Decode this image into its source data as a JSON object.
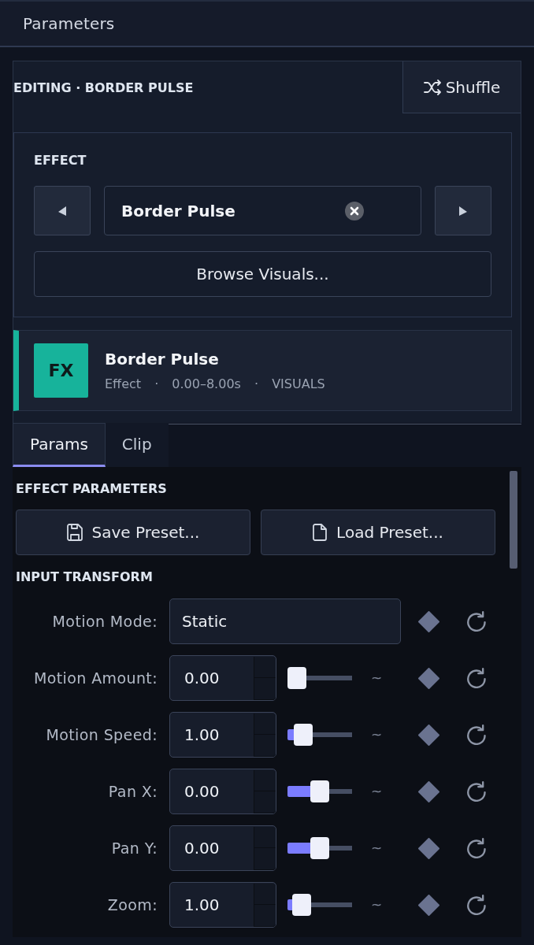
{
  "window": {
    "title": "Parameters"
  },
  "editing": {
    "label": "EDITING · BORDER PULSE",
    "shuffle_button": "Shuffle"
  },
  "effect": {
    "label": "EFFECT",
    "value": "Border Pulse",
    "browse_button": "Browse Visuals..."
  },
  "clip": {
    "badge": "FX",
    "name": "Border Pulse",
    "meta": "Effect · 0.00–8.00s · VISUALS"
  },
  "tabs": [
    {
      "label": "Params",
      "selected": true
    },
    {
      "label": "Clip",
      "selected": false
    }
  ],
  "effect_parameters": {
    "title": "EFFECT PARAMETERS",
    "buttons": [
      {
        "kind": "save",
        "label": "Save Preset..."
      },
      {
        "kind": "load",
        "label": "Load Preset..."
      }
    ]
  },
  "input_transform": {
    "title": "INPUT TRANSFORM",
    "rows": [
      {
        "kind": "combo",
        "label": "Motion Mode:",
        "value": "Static"
      },
      {
        "kind": "slider",
        "label": "Motion Amount:",
        "value": "0.00",
        "level": 0,
        "modulation": "~"
      },
      {
        "kind": "slider",
        "label": "Motion Speed:",
        "value": "1.00",
        "level": 0.14,
        "modulation": "~"
      },
      {
        "kind": "slider",
        "label": "Pan X:",
        "value": "0.00",
        "level": 0.5,
        "modulation": "~"
      },
      {
        "kind": "slider",
        "label": "Pan Y:",
        "value": "0.00",
        "level": 0.5,
        "modulation": "~"
      },
      {
        "kind": "slider",
        "label": "Zoom:",
        "value": "1.00",
        "level": 0.1,
        "modulation": "~"
      }
    ]
  }
}
